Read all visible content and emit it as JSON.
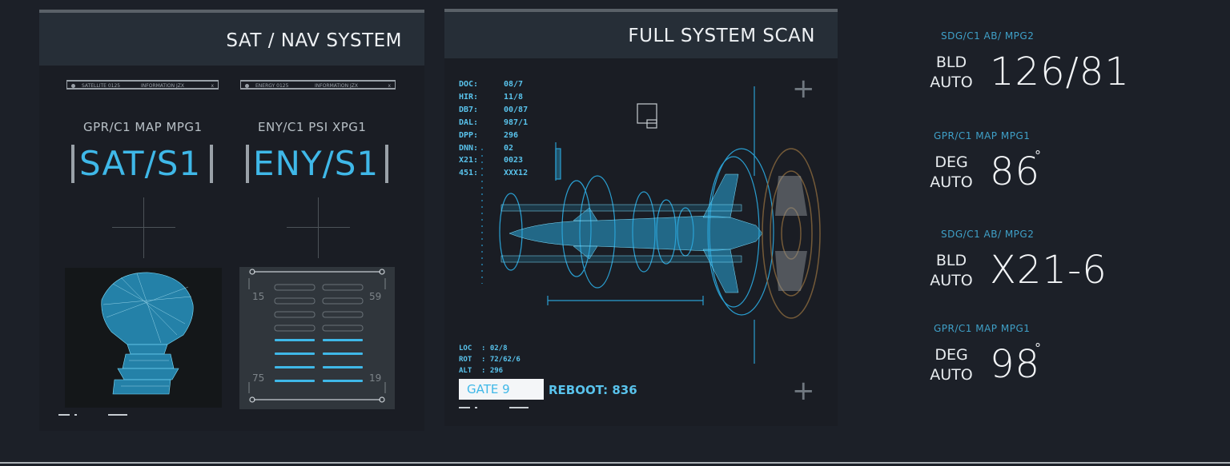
{
  "panel_sat": {
    "title": "SAT / NAV SYSTEM",
    "infobar_left": {
      "label": "SATELLITE 0125",
      "info": "INFORMATION JZX",
      "close": "x"
    },
    "infobar_right": {
      "label": "ENERGY 0125",
      "info": "INFORMATION JZX",
      "close": "x"
    },
    "sat_sub": "GPR/C1   MAP  MPG1",
    "sat_code": "SAT/S1",
    "eny_sub": "ENY/C1    PSI  XPG1",
    "eny_code": "ENY/S1",
    "gauge_left": [
      "15",
      "75"
    ],
    "gauge_right": [
      "59",
      "19"
    ]
  },
  "panel_scan": {
    "title": "FULL SYSTEM SCAN",
    "stats": [
      {
        "k": "DOC:",
        "v": "08/7"
      },
      {
        "k": "HIR:",
        "v": "11/8"
      },
      {
        "k": "DB7:",
        "v": "00/87"
      },
      {
        "k": "DAL:",
        "v": "987/1"
      },
      {
        "k": "DPP:",
        "v": "296"
      },
      {
        "k": "DNN:",
        "v": "02"
      },
      {
        "k": "X21:",
        "v": "0023"
      },
      {
        "k": "451:",
        "v": "XXX12"
      }
    ],
    "loc": [
      {
        "k": "LOC",
        "v": ": 02/8"
      },
      {
        "k": "ROT",
        "v": ": 72/62/6"
      },
      {
        "k": "ALT",
        "v": ": 296"
      }
    ],
    "gate": "GATE 9",
    "reboot": "REBOOT: 836"
  },
  "readouts": [
    {
      "sub": "SDG/C1   AB/  MPG2",
      "l1": "BLD",
      "l2": "AUTO",
      "value": "126/81",
      "deg": ""
    },
    {
      "sub": "GPR/C1   MAP   MPG1",
      "l1": "DEG",
      "l2": "AUTO",
      "value": "86",
      "deg": "°"
    },
    {
      "sub": "SDG/C1   AB/  MPG2",
      "l1": "BLD",
      "l2": "AUTO",
      "value": "X21-6",
      "deg": ""
    },
    {
      "sub": "GPR/C1   MAP   MPG1",
      "l1": "DEG",
      "l2": "AUTO",
      "value": "98",
      "deg": "°"
    }
  ],
  "colors": {
    "accent": "#3fb8e8",
    "background": "#1c2028",
    "panel_header": "#262e37"
  }
}
